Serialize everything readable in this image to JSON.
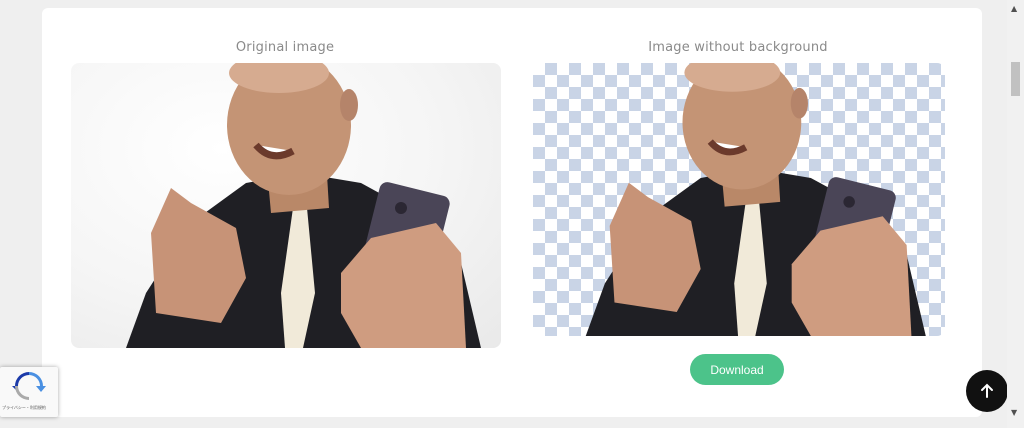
{
  "original": {
    "caption": "Original image"
  },
  "result": {
    "caption": "Image without background"
  },
  "download": {
    "label": "Download"
  },
  "recaptcha": {
    "text": "プライバシー・利用規約"
  },
  "colors": {
    "download": "#4cc38a",
    "checker": "#c9d4e6",
    "to_top": "#111111"
  },
  "icons": {
    "to_top": "arrow-up-icon",
    "recaptcha": "recaptcha-logo-icon"
  }
}
